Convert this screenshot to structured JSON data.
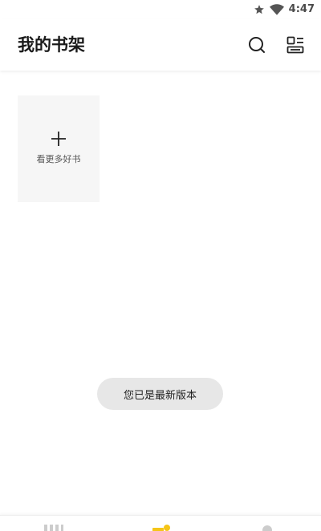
{
  "status_bar": {
    "time": "4:47",
    "icons": [
      "star-icon",
      "wifi-icon",
      "battery-icon"
    ]
  },
  "header": {
    "title": "我的书架",
    "icons": [
      "search-icon",
      "layout-icon"
    ]
  },
  "shelf": {
    "add_card_label": "看更多好书",
    "add_icon": "plus-icon"
  },
  "toast": {
    "message": "您已是最新版本"
  },
  "bottom_nav": {
    "items": [
      "bookstore-icon",
      "bookshelf-icon",
      "profile-icon"
    ],
    "active_color": "#f5c518",
    "inactive_color": "#cccccc"
  },
  "colors": {
    "accent": "#f5c518",
    "card_bg": "#f6f6f6",
    "toast_bg": "#e7e7e7"
  }
}
